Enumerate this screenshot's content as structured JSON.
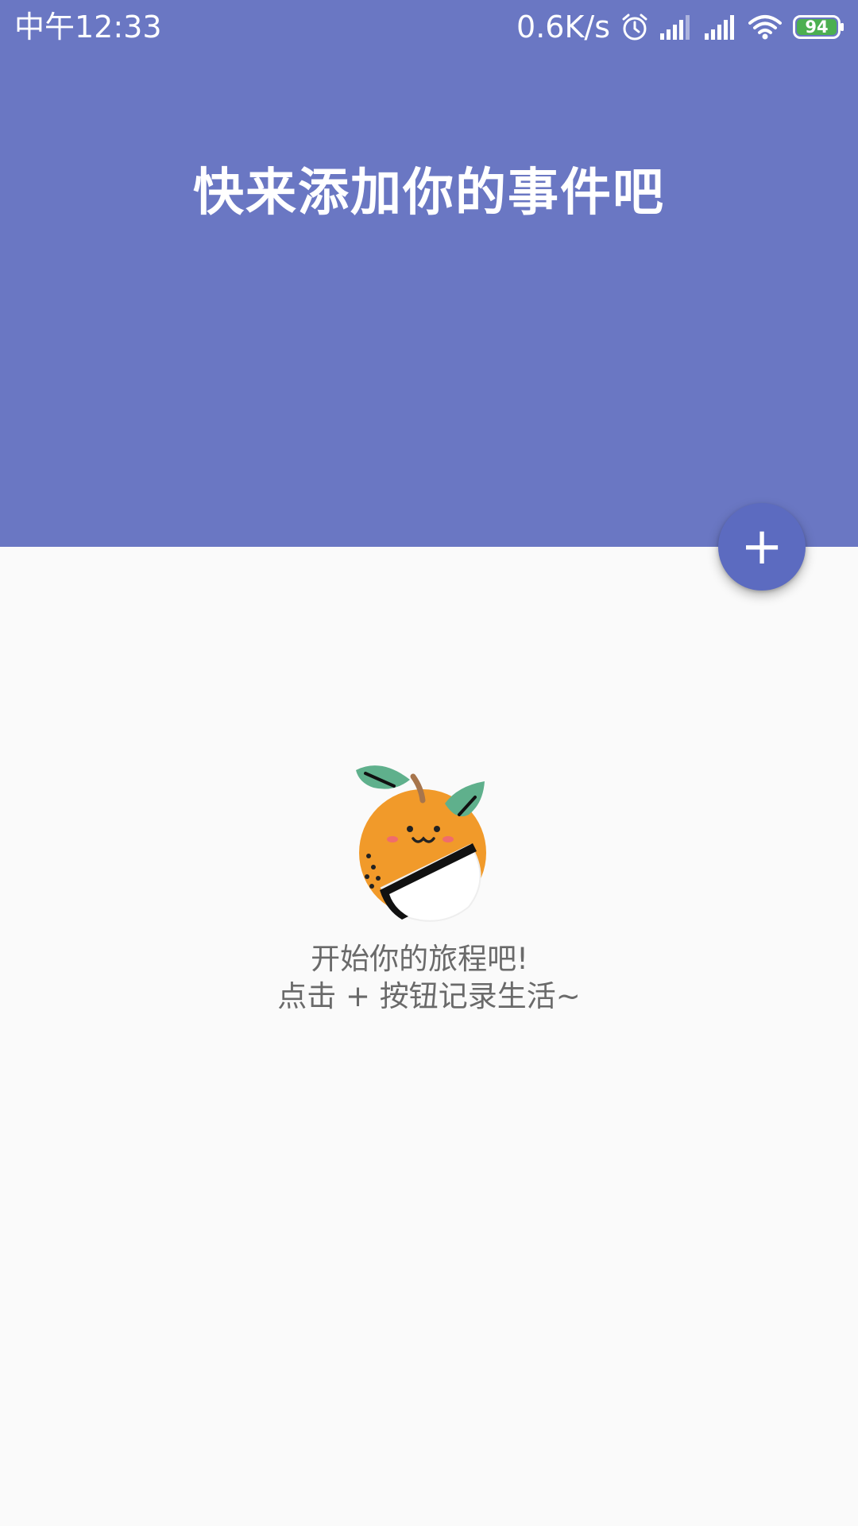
{
  "status_bar": {
    "time": "中午12:33",
    "net_speed": "0.6K/s",
    "battery_level": "94",
    "icons": [
      "alarm-icon",
      "signal-icon",
      "signal-icon",
      "wifi-icon",
      "battery-icon"
    ],
    "battery_color": "#4caf50"
  },
  "header": {
    "title": "快来添加你的事件吧",
    "background_color": "#6a77c3"
  },
  "fab": {
    "label": "+",
    "color": "#5c6bc0"
  },
  "empty_state": {
    "mascot": "orange-mascot-icon",
    "line1": "开始你的旅程吧!",
    "line2": "点击 + 按钮记录生活~"
  }
}
